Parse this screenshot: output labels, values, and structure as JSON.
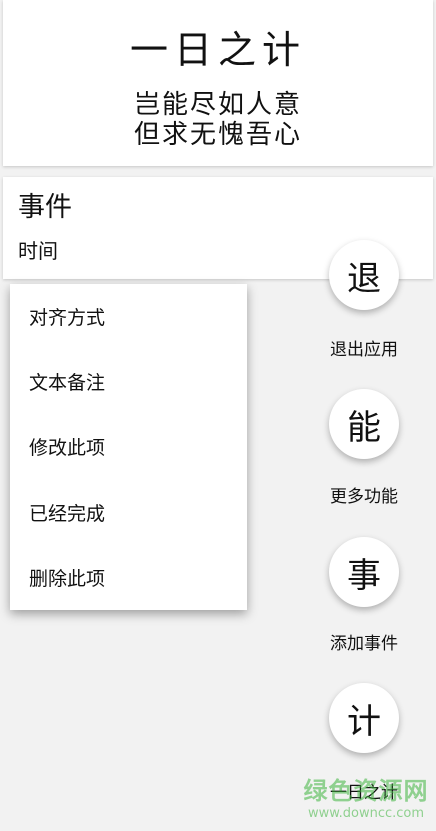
{
  "header": {
    "title": "一日之计",
    "motto_line1": "岂能尽如人意",
    "motto_line2": "但求无愧吾心"
  },
  "event": {
    "title": "事件",
    "time_label": "时间"
  },
  "context_menu": {
    "items": [
      {
        "label": "对齐方式"
      },
      {
        "label": "文本备注"
      },
      {
        "label": "修改此项"
      },
      {
        "label": "已经完成"
      },
      {
        "label": "删除此项"
      }
    ]
  },
  "fab_actions": [
    {
      "glyph": "退",
      "label": "退出应用"
    },
    {
      "glyph": "能",
      "label": "更多功能"
    },
    {
      "glyph": "事",
      "label": "添加事件"
    },
    {
      "glyph": "计",
      "label": "一日之计"
    }
  ],
  "watermark": {
    "title": "绿色资源网",
    "url": "www.downcc.com",
    "color": "#3fb53f"
  }
}
